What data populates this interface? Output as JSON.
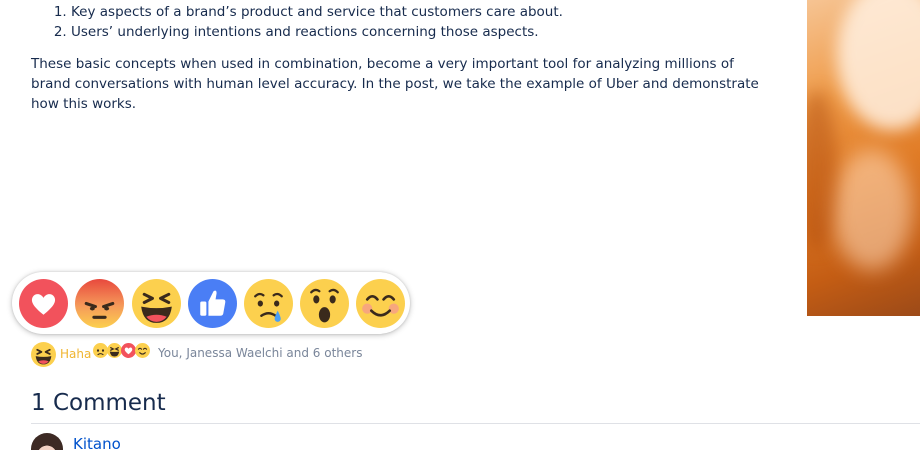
{
  "article": {
    "list_items": [
      "Key aspects of a brand’s product and service that customers care about.",
      "Users’ underlying intentions and reactions concerning those aspects."
    ],
    "paragraph": "These basic concepts when used in combination, become a very important tool for analyzing millions of brand conversations with human level accuracy. In the post, we take the example of Uber and demonstrate how this works."
  },
  "reactions": {
    "picker_options": [
      "love-icon",
      "angry-icon",
      "haha-icon",
      "like-icon",
      "sad-icon",
      "wow-icon",
      "smile-icon"
    ],
    "selected_label": "Haha",
    "summary_text": "You, Janessa Waelchi and 6 others",
    "colors": {
      "love": "#f2525c",
      "angry": "#ef6a4a",
      "face_yellow": "#fcd04e",
      "like": "#4a7ef5",
      "haha_text": "#f0b531"
    }
  },
  "comments": {
    "title": "1 Comment",
    "items": [
      {
        "author": "Kitano"
      }
    ]
  }
}
